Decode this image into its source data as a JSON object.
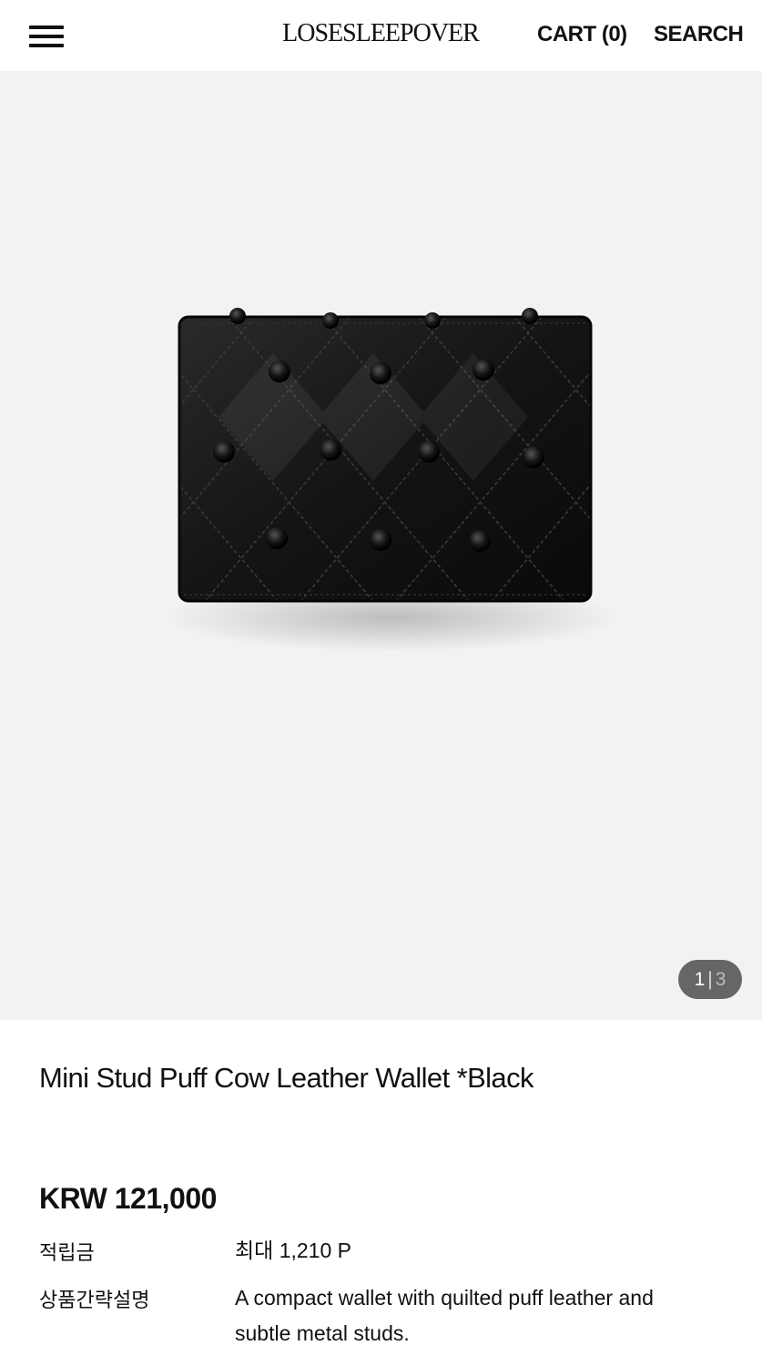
{
  "header": {
    "logo_text": "LOSESLEEPOVER",
    "cart_label": "CART (0)",
    "search_label": "SEARCH",
    "menu_icon": "hamburger-menu-icon"
  },
  "gallery": {
    "current": "1",
    "separator": "|",
    "total": "3",
    "background": "#f2f2f2"
  },
  "product": {
    "title": "Mini Stud Puff Cow Leather Wallet *Black",
    "price": "KRW 121,000",
    "details": [
      {
        "label": "적립금",
        "value": "최대 1,210 P"
      },
      {
        "label": "상품간략설명",
        "value": "A compact wallet with quilted puff leather and subtle metal studs."
      }
    ]
  }
}
